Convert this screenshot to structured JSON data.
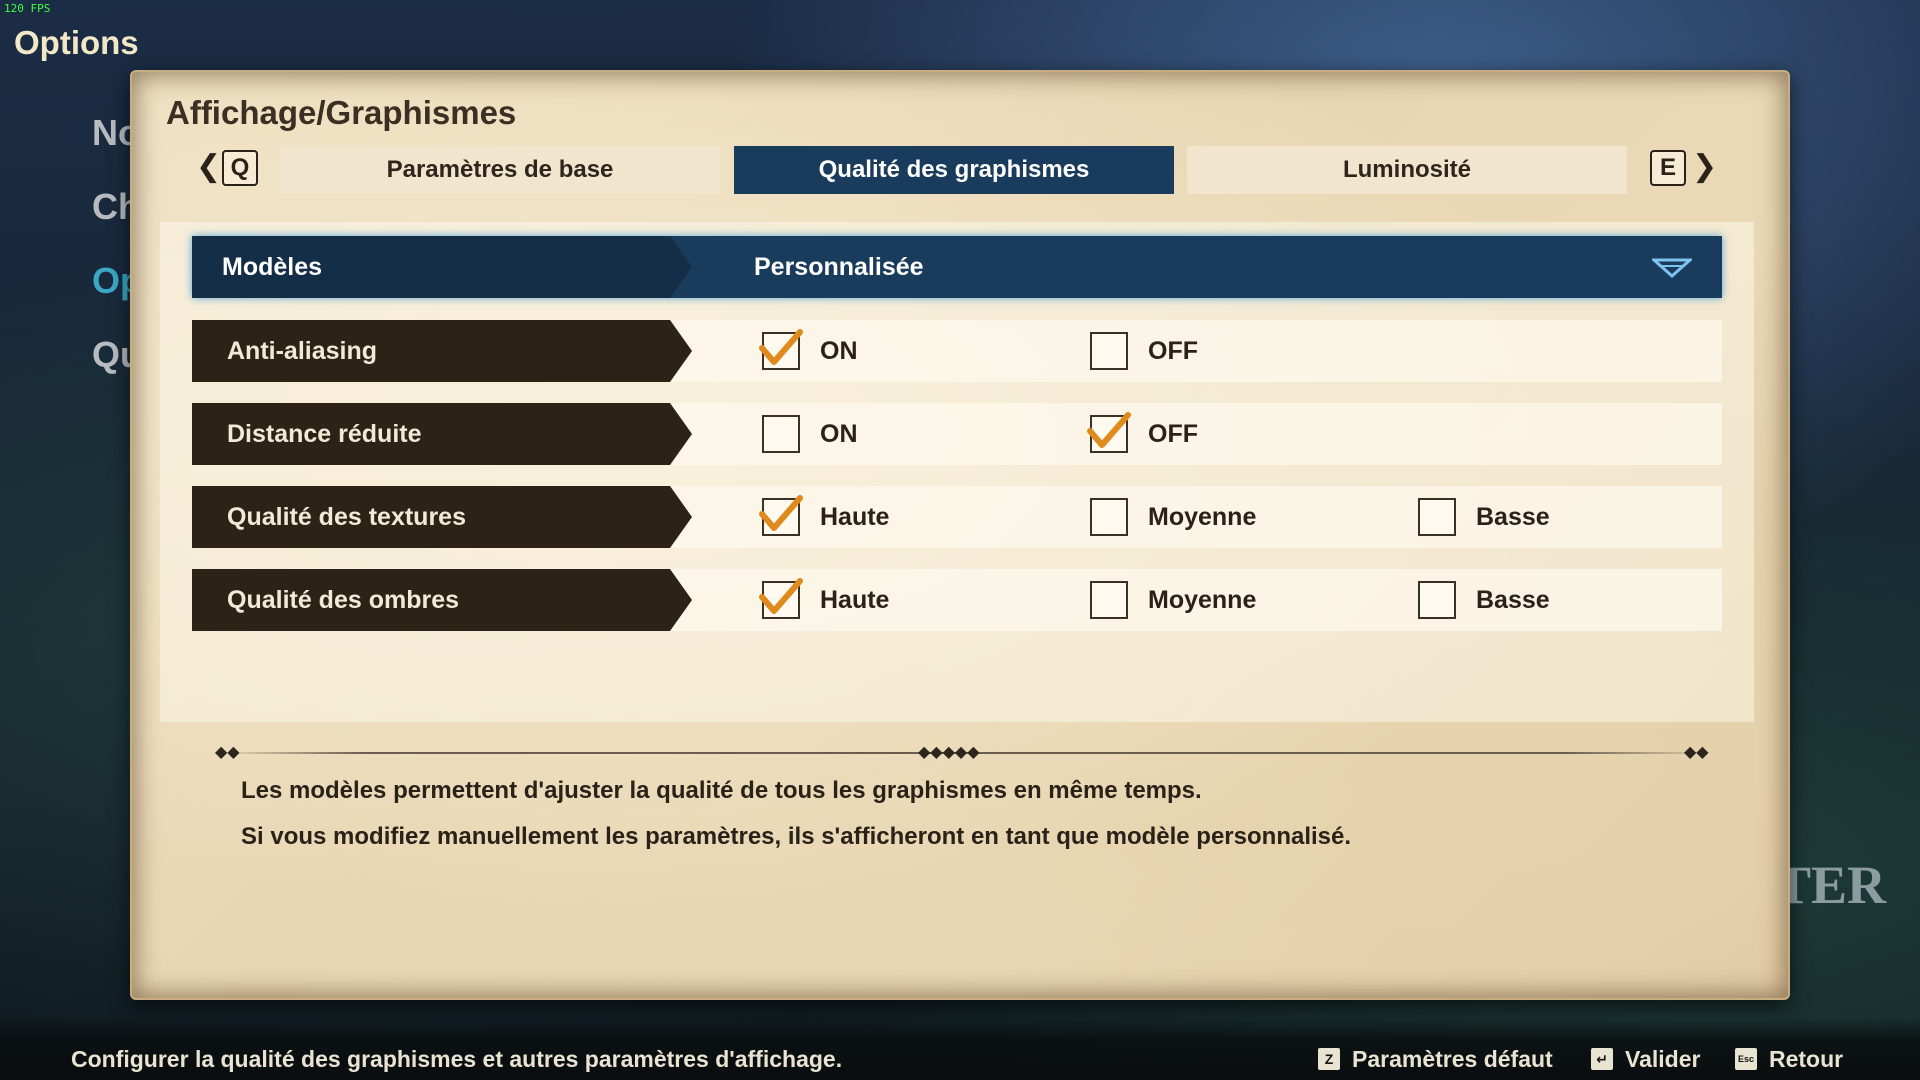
{
  "hud": {
    "fps": "120 FPS"
  },
  "screen": {
    "title": "Options",
    "watermark": "TER"
  },
  "side_nav": [
    {
      "label": "No",
      "active": false
    },
    {
      "label": "Ch",
      "active": false
    },
    {
      "label": "Op",
      "active": true
    },
    {
      "label": "Qu",
      "active": false
    }
  ],
  "section": {
    "title": "Affichage/Graphismes"
  },
  "tabs": {
    "prev_key": "Q",
    "next_key": "E",
    "items": [
      {
        "label": "Paramètres de base",
        "active": false
      },
      {
        "label": "Qualité des graphismes",
        "active": true
      },
      {
        "label": "Luminosité",
        "active": false
      }
    ]
  },
  "settings": {
    "models": {
      "label": "Modèles",
      "value": "Personnalisée"
    },
    "anti_aliasing": {
      "label": "Anti-aliasing",
      "options": [
        {
          "label": "ON",
          "checked": true
        },
        {
          "label": "OFF",
          "checked": false
        }
      ]
    },
    "reduced_distance": {
      "label": "Distance réduite",
      "options": [
        {
          "label": "ON",
          "checked": false
        },
        {
          "label": "OFF",
          "checked": true
        }
      ]
    },
    "texture_quality": {
      "label": "Qualité des textures",
      "options": [
        {
          "label": "Haute",
          "checked": true
        },
        {
          "label": "Moyenne",
          "checked": false
        },
        {
          "label": "Basse",
          "checked": false
        }
      ]
    },
    "shadow_quality": {
      "label": "Qualité des ombres",
      "options": [
        {
          "label": "Haute",
          "checked": true
        },
        {
          "label": "Moyenne",
          "checked": false
        },
        {
          "label": "Basse",
          "checked": false
        }
      ]
    }
  },
  "description": {
    "line1": "Les modèles permettent d'ajuster la qualité de tous les graphismes en même temps.",
    "line2": "Si vous modifiez manuellement les paramètres, ils s'afficheront en tant que modèle personnalisé."
  },
  "footer": {
    "hint": "Configurer la qualité des graphismes et autres paramètres d'affichage.",
    "default_key": "Z",
    "default_label": "Paramètres défaut",
    "confirm_key": "↵",
    "confirm_label": "Valider",
    "back_key": "Esc",
    "back_label": "Retour"
  },
  "colors": {
    "accent_blue": "#1a3c5c",
    "check_orange": "#e08a1e",
    "parchment": "#ead9b7"
  }
}
